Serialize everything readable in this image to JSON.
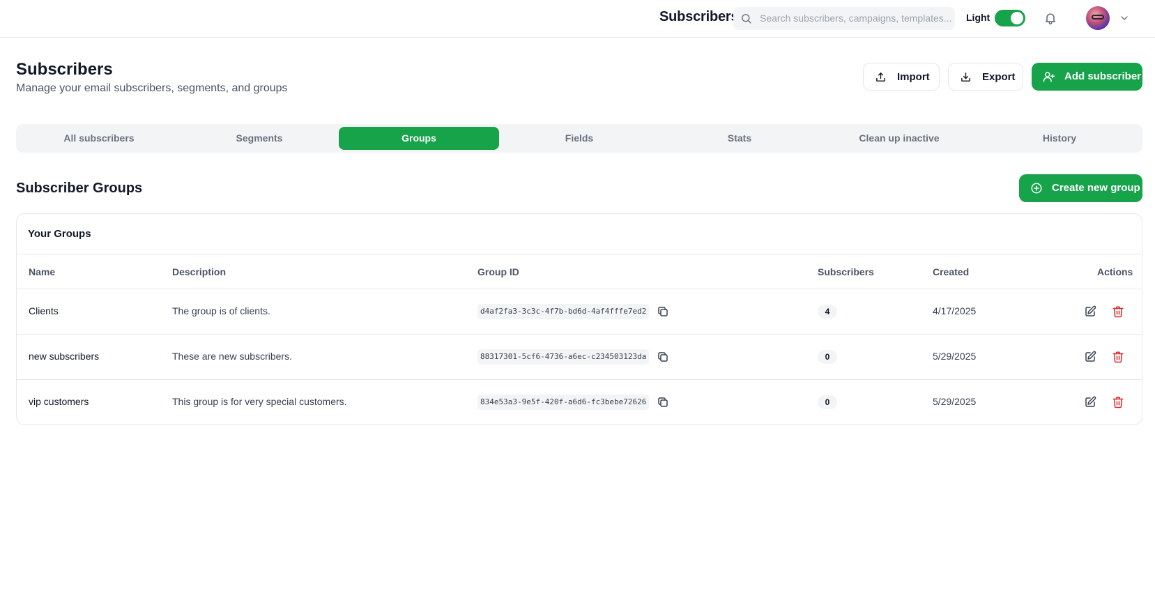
{
  "topbar": {
    "title": "Subscribers",
    "search_placeholder": "Search subscribers, campaigns, templates...",
    "theme_label": "Light",
    "theme_toggle_on": true,
    "icons": [
      "search-icon",
      "bell-icon",
      "avatar",
      "chevron-down-icon"
    ]
  },
  "header": {
    "title": "Subscribers",
    "subtitle": "Manage your email subscribers, segments, and groups",
    "import_label": "Import",
    "export_label": "Export",
    "add_label": "Add subscriber"
  },
  "tabs": [
    {
      "label": "All subscribers",
      "active": false
    },
    {
      "label": "Segments",
      "active": false
    },
    {
      "label": "Groups",
      "active": true
    },
    {
      "label": "Fields",
      "active": false
    },
    {
      "label": "Stats",
      "active": false
    },
    {
      "label": "Clean up inactive",
      "active": false
    },
    {
      "label": "History",
      "active": false
    }
  ],
  "section": {
    "title": "Subscriber Groups",
    "create_label": "Create new group"
  },
  "groups_card": {
    "title": "Your Groups",
    "columns": [
      "Name",
      "Description",
      "Group ID",
      "Subscribers",
      "Created",
      "Actions"
    ],
    "rows": [
      {
        "name": "Clients",
        "description": "The group is of clients.",
        "group_id": "d4af2fa3-3c3c-4f7b-bd6d-4af4fffe7ed2",
        "subscribers": "4",
        "created": "4/17/2025"
      },
      {
        "name": "new subscribers",
        "description": "These are new subscribers.",
        "group_id": "88317301-5cf6-4736-a6ec-c234503123da",
        "subscribers": "0",
        "created": "5/29/2025"
      },
      {
        "name": "vip customers",
        "description": "This group is for very special customers.",
        "group_id": "834e53a3-9e5f-420f-a6d6-fc3bebe72626",
        "subscribers": "0",
        "created": "5/29/2025"
      }
    ]
  },
  "colors": {
    "accent": "#16a34a",
    "danger": "#dc2626",
    "muted_bg": "#f3f4f6",
    "border": "#e5e7eb"
  }
}
